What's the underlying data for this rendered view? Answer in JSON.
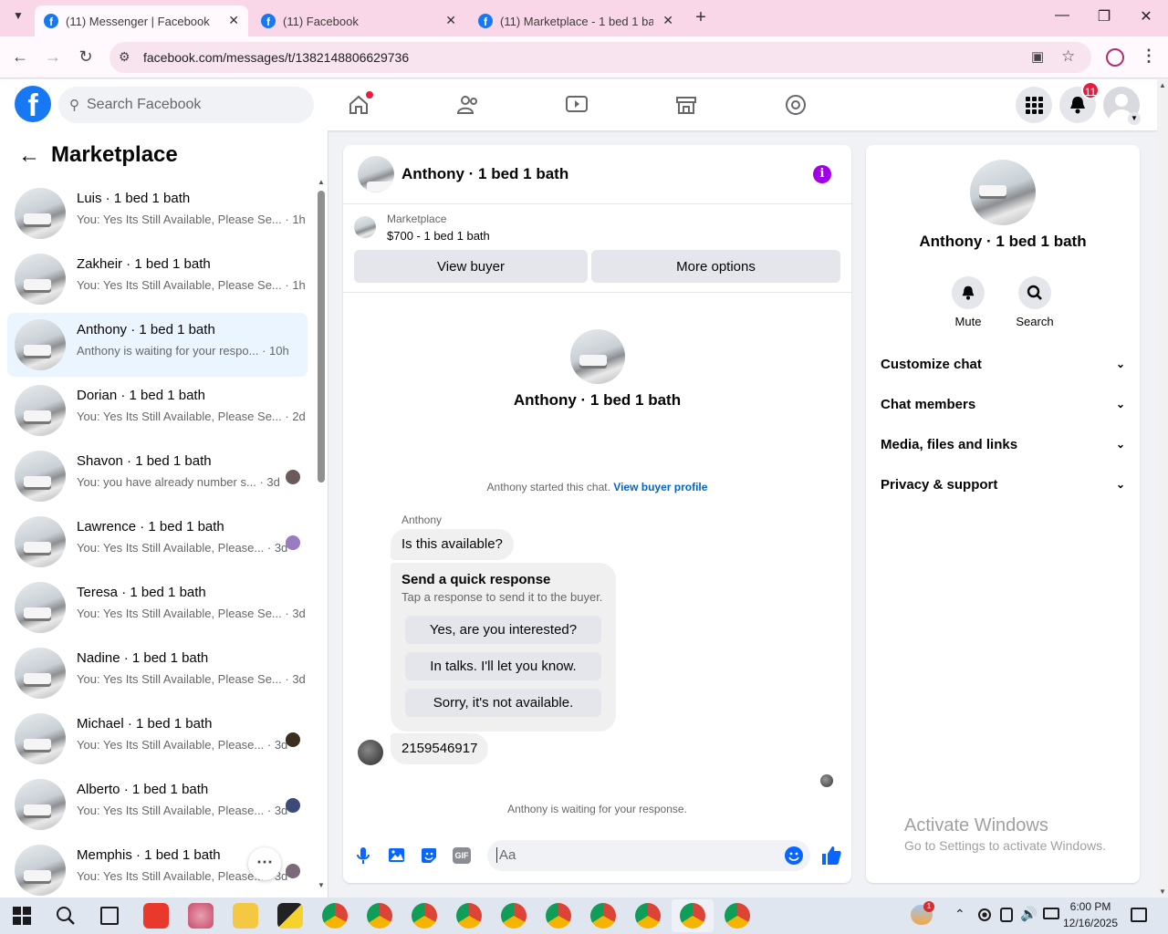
{
  "browser": {
    "tabs": [
      {
        "title": "(11) Messenger | Facebook",
        "active": true
      },
      {
        "title": "(11) Facebook",
        "active": false
      },
      {
        "title": "(11) Marketplace - 1 bed 1 bath",
        "active": false
      }
    ],
    "url": "facebook.com/messages/t/1382148806629736"
  },
  "header": {
    "search_placeholder": "Search Facebook",
    "notification_count": "11"
  },
  "sidebar": {
    "title": "Marketplace",
    "conversations": [
      {
        "name": "Luis · 1 bed 1 bath",
        "preview": "You: Yes Its Still Available, Please Se...",
        "time": "· 1h"
      },
      {
        "name": "Zakheir · 1 bed 1 bath",
        "preview": "You: Yes Its Still Available, Please Se...",
        "time": "· 1h"
      },
      {
        "name": "Anthony · 1 bed 1 bath",
        "preview": "Anthony is waiting for your respo...",
        "time": "· 10h"
      },
      {
        "name": "Dorian · 1 bed 1 bath",
        "preview": "You: Yes Its Still Available, Please Se...",
        "time": "· 2d"
      },
      {
        "name": "Shavon · 1 bed 1 bath",
        "preview": "You: you have already number s...",
        "time": "· 3d"
      },
      {
        "name": "Lawrence · 1 bed 1 bath",
        "preview": "You: Yes Its Still Available, Please...",
        "time": "· 3d"
      },
      {
        "name": "Teresa · 1 bed 1 bath",
        "preview": "You: Yes Its Still Available, Please Se...",
        "time": "· 3d"
      },
      {
        "name": "Nadine · 1 bed 1 bath",
        "preview": "You: Yes Its Still Available, Please Se...",
        "time": "· 3d"
      },
      {
        "name": "Michael · 1 bed 1 bath",
        "preview": "You: Yes Its Still Available, Please...",
        "time": "· 3d"
      },
      {
        "name": "Alberto · 1 bed 1 bath",
        "preview": "You: Yes Its Still Available, Please...",
        "time": "· 3d"
      },
      {
        "name": "Memphis · 1 bed 1 bath",
        "preview": "You: Yes Its Still Available, Please...",
        "time": "· 3d"
      }
    ]
  },
  "chat": {
    "title": "Anthony · 1 bed 1 bath",
    "listing_source": "Marketplace",
    "listing_title": "$700 - 1 bed 1 bath",
    "view_buyer": "View buyer",
    "more_options": "More options",
    "profile_name": "Anthony · 1 bed 1 bath",
    "started_text": "Anthony started this chat.",
    "view_buyer_profile": "View buyer profile",
    "sender": "Anthony",
    "message1": "Is this available?",
    "quick_title": "Send a quick response",
    "quick_sub": "Tap a response to send it to the buyer.",
    "quick_responses": [
      "Yes, are you interested?",
      "In talks. I'll let you know.",
      "Sorry, it's not available."
    ],
    "message2": "2159546917",
    "waiting_text": "Anthony is waiting for your response.",
    "composer_placeholder": "Aa"
  },
  "details": {
    "name": "Anthony · 1 bed 1 bath",
    "mute": "Mute",
    "search": "Search",
    "sections": [
      "Customize chat",
      "Chat members",
      "Media, files and links",
      "Privacy & support"
    ]
  },
  "watermark": {
    "title": "Activate Windows",
    "subtitle": "Go to Settings to activate Windows."
  },
  "taskbar": {
    "time": "6:00 PM",
    "date": "12/16/2025",
    "weather_badge": "1"
  }
}
